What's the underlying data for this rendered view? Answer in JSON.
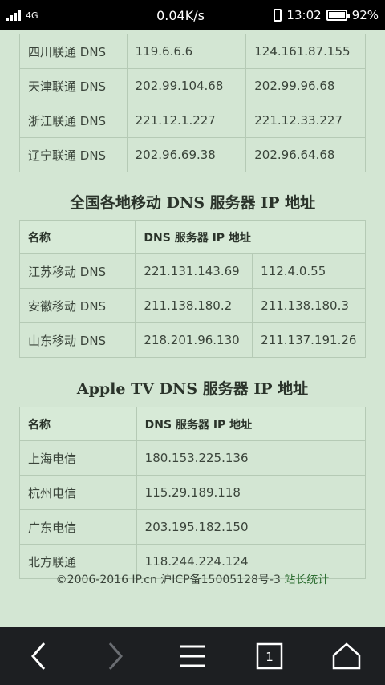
{
  "status": {
    "net_type": "4G",
    "sim": "2",
    "speed": "0.04K/s",
    "time": "13:02",
    "battery": "92%",
    "battery_level": 0.92
  },
  "top_table": {
    "rows": [
      [
        "四川联通 DNS",
        "119.6.6.6",
        "124.161.87.155"
      ],
      [
        "天津联通 DNS",
        "202.99.104.68",
        "202.99.96.68"
      ],
      [
        "浙江联通 DNS",
        "221.12.1.227",
        "221.12.33.227"
      ],
      [
        "辽宁联通 DNS",
        "202.96.69.38",
        "202.96.64.68"
      ]
    ]
  },
  "mobile_section": {
    "title": "全国各地移动 DNS 服务器 IP 地址",
    "headers": [
      "名称",
      "DNS 服务器 IP 地址"
    ],
    "rows": [
      [
        "江苏移动 DNS",
        "221.131.143.69",
        "112.4.0.55"
      ],
      [
        "安徽移动 DNS",
        "211.138.180.2",
        "211.138.180.3"
      ],
      [
        "山东移动 DNS",
        "218.201.96.130",
        "211.137.191.26"
      ]
    ]
  },
  "apple_section": {
    "title": "Apple TV DNS 服务器 IP 地址",
    "headers": [
      "名称",
      "DNS 服务器 IP 地址"
    ],
    "rows": [
      [
        "上海电信",
        "180.153.225.136"
      ],
      [
        "杭州电信",
        "115.29.189.118"
      ],
      [
        "广东电信",
        "203.195.182.150"
      ],
      [
        "北方联通",
        "118.244.224.124"
      ]
    ]
  },
  "footer": {
    "copyright": "©2006-2016 IP.cn 沪ICP备15005128号-3",
    "stats_link": "站长统计"
  },
  "nav": {
    "tab_count": "1"
  }
}
